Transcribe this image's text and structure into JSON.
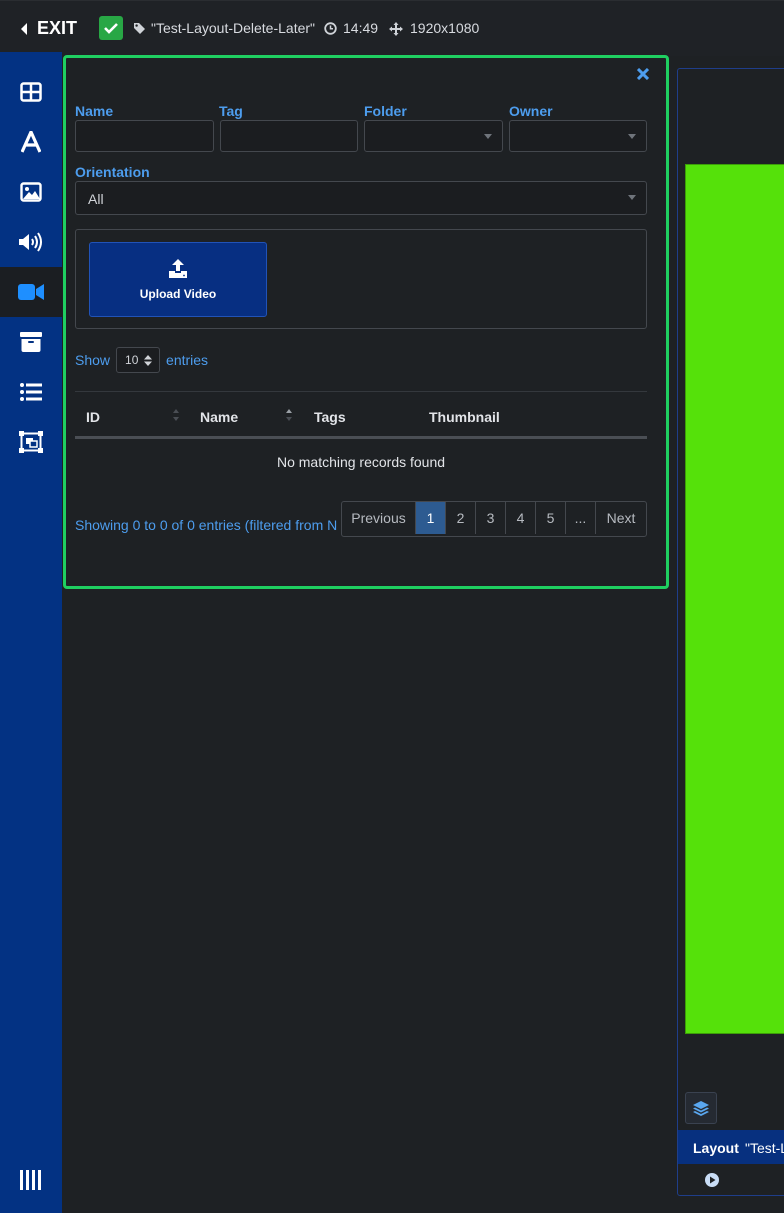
{
  "topbar": {
    "exit_label": "EXIT",
    "layout_name": "\"Test-Layout-Delete-Later\"",
    "duration": "14:49",
    "resolution": "1920x1080",
    "status_color": "#28a745"
  },
  "sidebar": {
    "items": [
      {
        "icon": "layout-grid-icon"
      },
      {
        "icon": "text-icon"
      },
      {
        "icon": "image-icon"
      },
      {
        "icon": "audio-icon"
      },
      {
        "icon": "video-icon",
        "active": true
      },
      {
        "icon": "archive-icon"
      },
      {
        "icon": "list-icon"
      },
      {
        "icon": "region-icon"
      }
    ],
    "bottom_icon": "library-icon",
    "background": "#033283"
  },
  "panel": {
    "border_color": "#1fcf61",
    "filters": {
      "name_label": "Name",
      "name_value": "",
      "tag_label": "Tag",
      "tag_value": "",
      "folder_label": "Folder",
      "folder_value": "",
      "owner_label": "Owner",
      "owner_value": "",
      "orientation_label": "Orientation",
      "orientation_value": "All"
    },
    "upload_label": "Upload Video",
    "show_label": "Show",
    "page_length": "10",
    "entries_label": "entries",
    "columns": [
      "ID",
      "Name",
      "Tags",
      "Thumbnail"
    ],
    "empty_message": "No matching records found",
    "info": "Showing 0 to 0 of 0 entries (filtered from N",
    "pagination": {
      "previous": "Previous",
      "pages": [
        "1",
        "2",
        "3",
        "4",
        "5",
        "..."
      ],
      "current": "1",
      "next": "Next"
    }
  },
  "preview": {
    "canvas_color": "#55e10a",
    "bar_label": "Layout",
    "bar_name": "\"Test-L"
  }
}
